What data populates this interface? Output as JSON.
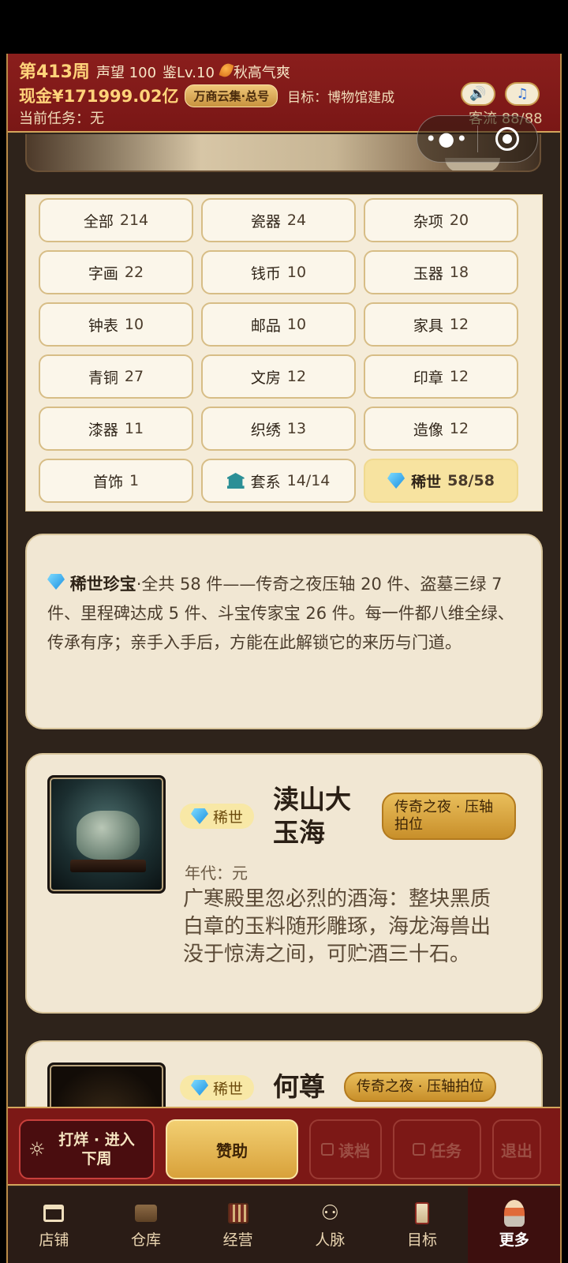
{
  "header": {
    "week": "第413周",
    "reputation": "声望 100",
    "appraisal": "鉴Lv.10",
    "season": "秋高气爽",
    "cash": "现金¥171999.02亿",
    "market_badge": "万商云集·总号",
    "goal": "目标：博物馆建成",
    "task": "当前任务：无",
    "traffic": "客流 88/88"
  },
  "categories": [
    {
      "name": "全部",
      "count": "214"
    },
    {
      "name": "瓷器",
      "count": "24"
    },
    {
      "name": "杂项",
      "count": "20"
    },
    {
      "name": "字画",
      "count": "22"
    },
    {
      "name": "钱币",
      "count": "10"
    },
    {
      "name": "玉器",
      "count": "18"
    },
    {
      "name": "钟表",
      "count": "10"
    },
    {
      "name": "邮品",
      "count": "10"
    },
    {
      "name": "家具",
      "count": "12"
    },
    {
      "name": "青铜",
      "count": "27"
    },
    {
      "name": "文房",
      "count": "12"
    },
    {
      "name": "印章",
      "count": "12"
    },
    {
      "name": "漆器",
      "count": "11"
    },
    {
      "name": "织绣",
      "count": "13"
    },
    {
      "name": "造像",
      "count": "12"
    },
    {
      "name": "首饰",
      "count": "1"
    },
    {
      "name": "套系",
      "count": "14/14"
    },
    {
      "name": "稀世",
      "count": "58/58"
    }
  ],
  "info": {
    "title": "稀世珍宝",
    "body": "·全共 58 件——传奇之夜压轴 20 件、盗墓三绿 7 件、里程碑达成 5 件、斗宝传家宝 26 件。每一件都八维全绿、传承有序；亲手入手后，方能在此解锁它的来历与门道。"
  },
  "items": [
    {
      "badge": "稀世",
      "name_line1": "渎山大",
      "name_line2": "玉海",
      "source": "传奇之夜 · 压轴拍位",
      "era": "年代：元",
      "desc": "广寒殿里忽必烈的酒海：整块黑质白章的玉料随形雕琢，海龙海兽出没于惊涛之间，可贮酒三十石。"
    },
    {
      "badge": "稀世",
      "name_line1": "何尊",
      "source": "传奇之夜 · 压轴拍位"
    }
  ],
  "actions": {
    "next_week": "打烊 · 进入下周",
    "sponsor": "赞助",
    "load": "读档",
    "task": "任务",
    "exit": "退出"
  },
  "tabs": [
    "店铺",
    "仓库",
    "经营",
    "人脉",
    "目标",
    "更多"
  ],
  "icons": {
    "season": "leaf-icon",
    "sound": "speaker-icon",
    "music": "music-note-icon",
    "rare": "diamond-icon",
    "set": "museum-icon"
  },
  "colors": {
    "header_red": "#7a1716",
    "gold": "#d8a13a",
    "cream": "#f1e7d3"
  }
}
